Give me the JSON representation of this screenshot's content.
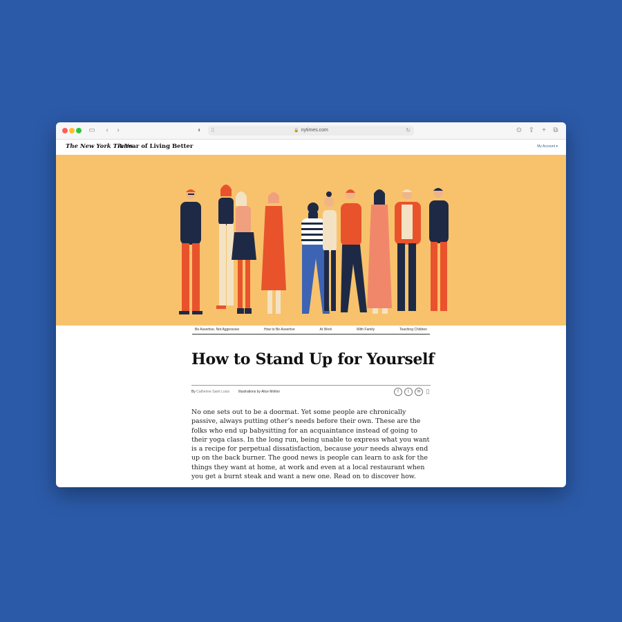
{
  "browser": {
    "url": "nytimes.com"
  },
  "header": {
    "logo": "The New York Times",
    "series": "A Year of Living Better",
    "account": "My Account"
  },
  "nav": {
    "items": [
      "Be Assertive, Not Aggressive",
      "How to Be Assertive",
      "At Work",
      "With Family",
      "Teaching Children"
    ]
  },
  "article": {
    "headline": "How to Stand Up for Yourself",
    "byline_prefix": "By",
    "author": "Catherine Saint Louis",
    "illustrations": "Illustrations by Alice Mollon",
    "body_before_italic": "No one sets out to be a doormat. Yet some people are chronically passive, always putting other’s needs before their own. These are the folks who end up babysitting for an acquaintance instead of going to their yoga class. In the long run, being unable to express what you want is a recipe for perpetual dissatisfaction, because ",
    "body_italic": "your",
    "body_after_italic": " needs always end up on the back burner. The good news is people can learn to ask for the things they want at home, at work and even at a local restaurant when you get a burnt steak and want a new one. Read on to discover how."
  },
  "colors": {
    "background": "#2b5aa8",
    "hero": "#f8c26c",
    "orange": "#e8532c",
    "navy": "#1e2a45",
    "cream": "#f3e3c4"
  }
}
